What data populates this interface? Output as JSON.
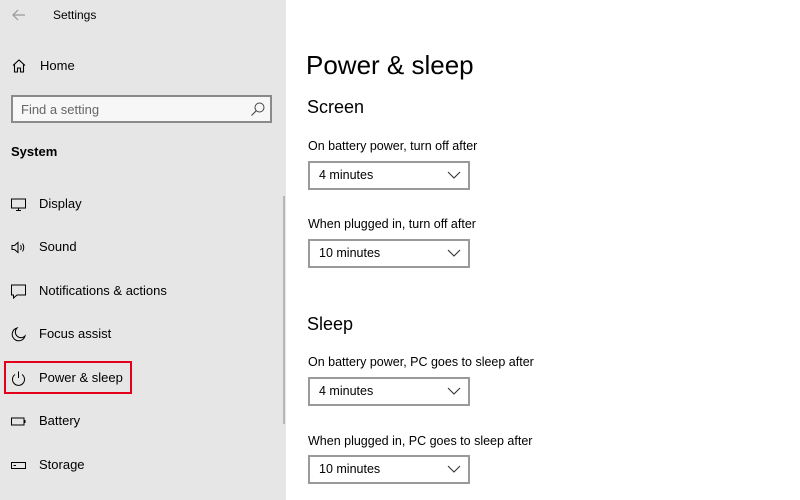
{
  "window": {
    "title": "Settings"
  },
  "sidebar": {
    "home_label": "Home",
    "search_placeholder": "Find a setting",
    "section_header": "System",
    "items": [
      {
        "label": "Display",
        "icon": "display-icon"
      },
      {
        "label": "Sound",
        "icon": "sound-icon"
      },
      {
        "label": "Notifications & actions",
        "icon": "notifications-icon"
      },
      {
        "label": "Focus assist",
        "icon": "focus-assist-icon"
      },
      {
        "label": "Power & sleep",
        "icon": "power-icon",
        "selected": true
      },
      {
        "label": "Battery",
        "icon": "battery-icon"
      },
      {
        "label": "Storage",
        "icon": "storage-icon"
      }
    ]
  },
  "main": {
    "title": "Power & sleep",
    "screen": {
      "heading": "Screen",
      "battery_label": "On battery power, turn off after",
      "battery_value": "4 minutes",
      "plugged_label": "When plugged in, turn off after",
      "plugged_value": "10 minutes"
    },
    "sleep": {
      "heading": "Sleep",
      "battery_label": "On battery power, PC goes to sleep after",
      "battery_value": "4 minutes",
      "plugged_label": "When plugged in, PC goes to sleep after",
      "plugged_value": "10 minutes"
    }
  },
  "colors": {
    "sidebar_bg": "#e6e6e6",
    "highlight_border": "#e3001b",
    "main_bg": "#ffffff"
  }
}
